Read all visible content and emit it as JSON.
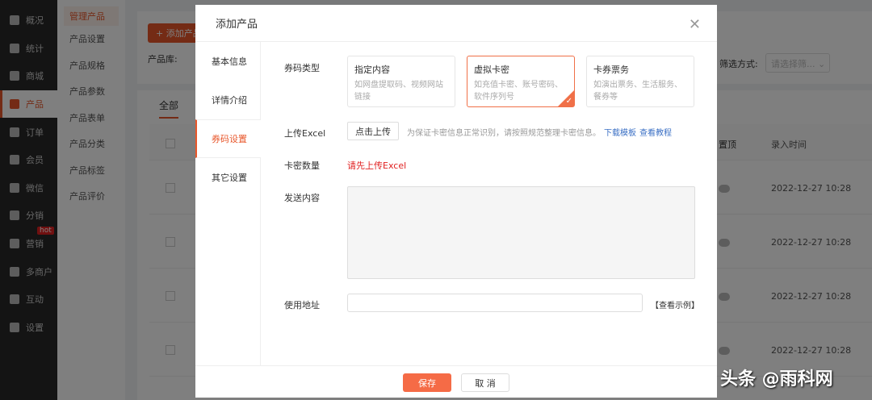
{
  "sidebar": {
    "items": [
      {
        "label": "概况"
      },
      {
        "label": "统计"
      },
      {
        "label": "商城"
      },
      {
        "label": "产品",
        "active": true
      },
      {
        "label": "订单"
      },
      {
        "label": "会员"
      },
      {
        "label": "微信"
      },
      {
        "label": "分销"
      },
      {
        "label": "营销",
        "badge": "hot"
      },
      {
        "label": "多商户"
      },
      {
        "label": "互动"
      },
      {
        "label": "设置"
      }
    ]
  },
  "submenu": {
    "items": [
      "管理产品",
      "产品设置",
      "产品规格",
      "产品参数",
      "产品表单",
      "产品分类",
      "产品标签",
      "产品评价"
    ]
  },
  "main": {
    "add_button": "+ 添加产品",
    "filter_label": "产品库:",
    "filter_method_label": "筛选方式:",
    "filter_placeholder": "请选择筛...",
    "tab_all": "全部",
    "col_top": "置顶",
    "col_time": "录入时间",
    "rows": [
      "2022-12-27 10:28",
      "2022-12-27 10:28",
      "2022-12-27 10:28",
      "2022-12-27 10:28"
    ]
  },
  "modal": {
    "title": "添加产品",
    "tabs": [
      "基本信息",
      "详情介绍",
      "券码设置",
      "其它设置"
    ],
    "code_type_label": "券码类型",
    "cards": [
      {
        "title": "指定内容",
        "desc": "如网盘提取码、视频网站链接"
      },
      {
        "title": "虚拟卡密",
        "desc": "如充值卡密、账号密码、软件序列号"
      },
      {
        "title": "卡券票务",
        "desc": "如演出票务、生活服务、餐券等"
      }
    ],
    "upload_label": "上传Excel",
    "upload_button": "点击上传",
    "upload_hint": "为保证卡密信息正常识别，请按照规范整理卡密信息。",
    "download_link": "下载模板",
    "tutorial_link": "查看教程",
    "count_label": "卡密数量",
    "count_error": "请先上传Excel",
    "content_label": "发送内容",
    "address_label": "使用地址",
    "example_link": "【查看示例】",
    "save": "保存",
    "cancel": "取 消"
  },
  "watermark": "头条 @雨科网",
  "colors": {
    "accent": "#e8572b",
    "link": "#3a6fc4",
    "error": "#e02020"
  }
}
